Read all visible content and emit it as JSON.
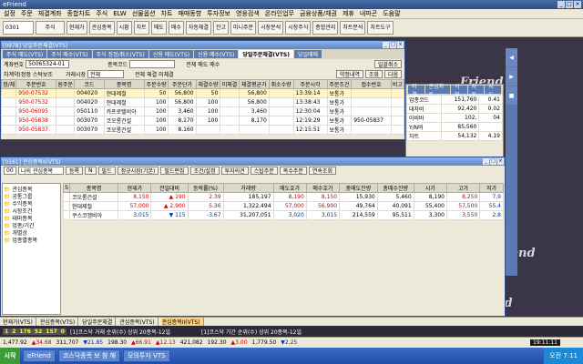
{
  "app": {
    "title": "eFriend",
    "controls": [
      "_",
      "□",
      "×"
    ]
  },
  "menu": [
    "설정",
    "주문",
    "체결계좌",
    "종합차트",
    "주식",
    "ELW",
    "선물옵션",
    "차트",
    "매매동향",
    "투자정보",
    "영웅검색",
    "온라인업무",
    "금융상품/채권",
    "제휴",
    "내파곤",
    "도움말"
  ],
  "toolbar": {
    "code": "0301",
    "field": "주식",
    "buttons": [
      "현재가",
      "관심종목",
      "시황",
      "차트",
      "매도",
      "매수",
      "자동체결",
      "잔고",
      "미니주문",
      "시장분석",
      "시장주식",
      "종합관리",
      "차트분석",
      "차트도구"
    ]
  },
  "brand": "Friend",
  "order_win": {
    "title": "[0978] 당일주문체결(VTS)",
    "tabs": [
      "주식 매도(VTS)",
      "주식 매수(VTS)",
      "주식 정정/취소(VTS)",
      "신용 매도(VTS)",
      "신용 매수(VTS)",
      "당일주문체결(VTS)",
      "당일매매"
    ],
    "active_tab": "당일주문체결(VTS)",
    "account_label": "계좌번호",
    "account": "50065324-01",
    "code_label": "종목코드",
    "market_label": "거래시장",
    "market": "전체",
    "filter_label": "차계약(정정 스탁보조",
    "radio1": [
      "전체",
      "매도",
      "매수"
    ],
    "radio2": [
      "전체",
      "체결",
      "미체결"
    ],
    "buttons": [
      "일괄취소",
      "조회",
      "다음",
      "약정내역"
    ],
    "columns": [
      "정/체",
      "주문번호",
      "원주문",
      "코드",
      "종목명",
      "주문수량",
      "주문단가",
      "체결수량",
      "미체결",
      "체결평균가",
      "취소수량",
      "주문시각",
      "주문조건",
      "접수번호",
      "비고"
    ],
    "rows": [
      [
        "",
        "950-07532",
        "",
        "004020",
        "현대제철",
        "50",
        "56,800",
        "50",
        "",
        "56,800",
        "",
        "13:39:14",
        "보통가",
        "",
        ""
      ],
      [
        "",
        "950-07532",
        "",
        "004020",
        "현대제철",
        "100",
        "56,800",
        "100",
        "",
        "56,800",
        "",
        "13:38:43",
        "보통가",
        "",
        ""
      ],
      [
        "",
        "950-06095",
        "",
        "050110",
        "카프로텔비아",
        "100",
        "3,460",
        "100",
        "",
        "3,460",
        "",
        "12:30:04",
        "보통가",
        "",
        ""
      ],
      [
        "",
        "950-05838",
        "",
        "003070",
        "코오롱건설",
        "100",
        "8,170",
        "100",
        "",
        "8,170",
        "",
        "12:19:29",
        "보통가",
        "950-05837",
        ""
      ],
      [
        "",
        "950-05837",
        "",
        "003070",
        "코오롱건설",
        "100",
        "8,160",
        "",
        "",
        "",
        "",
        "12:15:51",
        "보통가",
        "",
        ""
      ]
    ]
  },
  "watch_win": {
    "title": "[0161] 관심종목II(VTS)",
    "group_no": "00",
    "group": "나의 관심종목",
    "btns": [
      "등록",
      "N",
      "필드",
      "정규시장(기본)",
      "필드편집",
      "조건/설정",
      "투자의견",
      "스탑주문",
      "복수주문",
      "연속조회"
    ],
    "tree": [
      "관심종목",
      "공통그룹",
      "수익종목",
      "시장조건",
      "테마종목",
      "업종/기간",
      "개별상",
      "업종별종목"
    ],
    "columns": [
      "S",
      "종목명",
      "현재가",
      "전일대비",
      "등락률(%)",
      "거래량",
      "매도호가",
      "매수호가",
      "총매도잔량",
      "총매수잔량",
      "시가",
      "고가",
      "저가"
    ],
    "rows": [
      {
        "name": "코오롱건설",
        "price": "8,150",
        "arrow": "▲",
        "chg": "190",
        "pct": "2.39",
        "vol": "185,197",
        "ask": "8,190",
        "bid": "8,150",
        "tot_ask": "15,930",
        "tot_bid": "5,460",
        "open": "8,190",
        "high": "8,250",
        "low": "7,9",
        "color": "red"
      },
      {
        "name": "현대제철",
        "price": "57,000",
        "arrow": "▲",
        "chg": "2,900",
        "pct": "5.36",
        "vol": "1,322,494",
        "ask": "57,000",
        "bid": "56,900",
        "tot_ask": "49,764",
        "tot_bid": "40,091",
        "open": "55,400",
        "high": "57,500",
        "low": "55,4",
        "color": "red"
      },
      {
        "name": "쿠스코엠비아",
        "price": "3,015",
        "arrow": "▼",
        "chg": "115",
        "pct": "-3.67",
        "vol": "31,207,051",
        "ask": "3,020",
        "bid": "3,015",
        "tot_ask": "214,559",
        "tot_bid": "95,511",
        "open": "3,300",
        "high": "3,550",
        "low": "2,8",
        "color": "blue"
      }
    ]
  },
  "side": {
    "tabs": [
      "미결",
      "관심차트",
      "시장",
      "차트",
      "지도"
    ],
    "labels": [
      "업종코드",
      "대차비",
      "아비바",
      "Y/N비",
      "차트",
      "외국계"
    ],
    "values": [
      [
        "151,760",
        "0.41"
      ],
      [
        "92,420",
        "0.02"
      ],
      [
        "102,",
        "04"
      ],
      [
        "85,560",
        ""
      ],
      [
        "54,132",
        "4.19"
      ]
    ]
  },
  "order_book": [
    "5,240",
    "50",
    "10",
    "10",
    "50",
    "70",
    "50",
    "10",
    "20",
    "10",
    "20"
  ],
  "taskstrip": [
    "현재가(VTS)",
    "관심종목(VTS)",
    "당일주문체결",
    "관심종목(VTS)",
    "관심종목II(VTS)"
  ],
  "ticker": {
    "nums": [
      "1",
      "2",
      "176",
      "52",
      "157",
      "0"
    ],
    "text": "[1]코스닥 거래 순위(수) 상위 20종목-12일",
    "text2": "[1]코스닥 기간 순위(수) 상위 20종목-12일"
  },
  "index": {
    "kospi": "1,477.92",
    "k_chg": "▲34.68",
    "vol": "311,707",
    "kp_chg": "▼21.85",
    "fut": "198.30",
    "f_chg": "▲66.91",
    "f_pct": "▲12.13",
    "val": "421,082",
    "k2": "192.30",
    "k3": "▲3.00",
    "k4": "1,779.50",
    "k5": "▼2.25",
    "clock": "19:11:11"
  },
  "winbar": {
    "start": "시작",
    "tasks": [
      "eFriend",
      "코스닥종목 보 참 해",
      "모의투자 VTS"
    ],
    "time": "오전 7:11"
  }
}
